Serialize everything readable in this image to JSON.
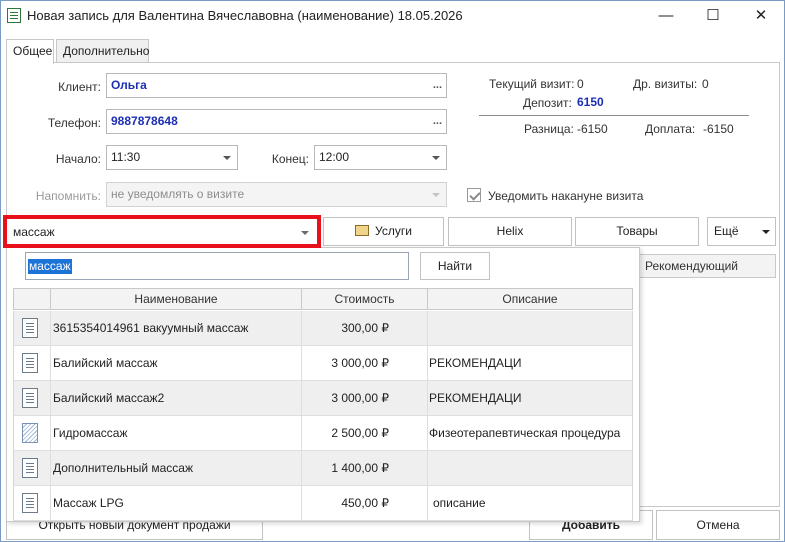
{
  "window": {
    "title": "Новая запись для Валентина Вячеславовна (наименование) 18.05.2026",
    "minimize": "—",
    "maximize": "☐",
    "close": "✕"
  },
  "tabs": [
    {
      "label": "Общее"
    },
    {
      "label": "Дополнительно"
    }
  ],
  "form": {
    "client_label": "Клиент:",
    "client_value": "Ольга",
    "phone_label": "Телефон:",
    "phone_value": "9887878648",
    "start_label": "Начало:",
    "start_value": "11:30",
    "end_label": "Конец:",
    "end_value": "12:00",
    "remind_label": "Напомнить:",
    "remind_value": "не уведомлять о визите",
    "notify_label": "Уведомить накануне визита",
    "ellipsis": "..."
  },
  "stats": {
    "current_visit_label": "Текущий визит:",
    "current_visit_value": "0",
    "other_visits_label": "Др. визиты:",
    "other_visits_value": "0",
    "deposit_label": "Депозит:",
    "deposit_value": "6150",
    "diff_label": "Разница:",
    "diff_value": "-6150",
    "surcharge_label": "Доплата:",
    "surcharge_value": "-6150"
  },
  "toolbar": {
    "search_combo_value": "массаж",
    "services_label": "Услуги",
    "helix_label": "Helix",
    "goods_label": "Товары",
    "more_label": "Ещё",
    "recommending_label": "Рекомендующий"
  },
  "popup": {
    "search_value": "массаж",
    "find_label": "Найти",
    "columns": [
      "Наименование",
      "Стоимость",
      "Описание"
    ],
    "rows": [
      {
        "name": "3615354014961 вакуумный массаж",
        "price": "300,00 ₽",
        "desc": "",
        "icon": "document-icon"
      },
      {
        "name": "Балийский массаж",
        "price": "3 000,00 ₽",
        "desc": "РЕКОМЕНДАЦИ",
        "icon": "document-icon"
      },
      {
        "name": "Балийский массаж2",
        "price": "3 000,00 ₽",
        "desc": "РЕКОМЕНДАЦИ",
        "icon": "document-icon"
      },
      {
        "name": "Гидромассаж",
        "price": "2 500,00 ₽",
        "desc": "Физеотерапевтическая процедура",
        "icon": "hatched-document-icon"
      },
      {
        "name": "Дополнительный массаж",
        "price": "1 400,00 ₽",
        "desc": "",
        "icon": "document-icon"
      },
      {
        "name": "Массаж LPG",
        "price": "450,00 ₽",
        "desc": "описание",
        "icon": "document-icon"
      }
    ]
  },
  "footer": {
    "open_doc_label": "Открыть новый документ продажи",
    "add_label": "Добавить",
    "cancel_label": "Отмена"
  },
  "colors": {
    "accent_bold": "#1c2fb3",
    "highlight_frame": "#e8101a",
    "selection": "#1e73d7"
  }
}
